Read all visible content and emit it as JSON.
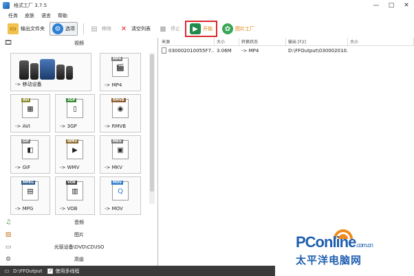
{
  "window": {
    "title": "格式工厂 3.7.5",
    "controls": [
      "—",
      "□",
      "✕"
    ]
  },
  "menu": [
    "任务",
    "皮肤",
    "语言",
    "帮助"
  ],
  "toolbar": {
    "output_folder": "输出文件夹",
    "options": "选项",
    "remove": "移除",
    "clear_list": "清空列表",
    "stop": "停止",
    "start": "开始",
    "picture_factory": "图片工厂"
  },
  "sidebar": {
    "video_header": "视频",
    "tiles": [
      {
        "label": "-> 移动设备",
        "badge": ""
      },
      {
        "label": "-> MP4",
        "badge": "MP4"
      },
      {
        "label": "-> AVI",
        "badge": "AVI"
      },
      {
        "label": "-> 3GP",
        "badge": "3GP"
      },
      {
        "label": "-> RMVB",
        "badge": "RMVB"
      },
      {
        "label": "-> GIF",
        "badge": "GIF"
      },
      {
        "label": "-> WMV",
        "badge": "WMV"
      },
      {
        "label": "-> MKV",
        "badge": "MKV"
      },
      {
        "label": "-> MPG",
        "badge": "MPEG"
      },
      {
        "label": "-> VOB",
        "badge": "VOB"
      },
      {
        "label": "-> MOV",
        "badge": "MOV"
      }
    ],
    "categories": [
      "音频",
      "图片",
      "光驱设备\\DVD\\CD\\ISO",
      "高级"
    ]
  },
  "table": {
    "headers": [
      "来源",
      "大小",
      "转换状态",
      "输出 [F2]",
      "大小"
    ],
    "rows": [
      {
        "source": "030002010055F7...",
        "size": "3.06M",
        "status": "-> MP4",
        "output": "D:\\FFOutput\\030002010...",
        "out_size": ""
      }
    ]
  },
  "statusbar": {
    "path": "D:\\FFOutput",
    "multithread_label": "使用多线程",
    "multithread_checked": true
  },
  "watermark": {
    "brand": "PConline",
    "domain": ".com.cn",
    "chinese": "太平洋电脑网"
  },
  "colors": {
    "start_highlight": "#d9262b",
    "accent_orange": "#e07a00",
    "watermark_blue": "#1f5fb0"
  }
}
